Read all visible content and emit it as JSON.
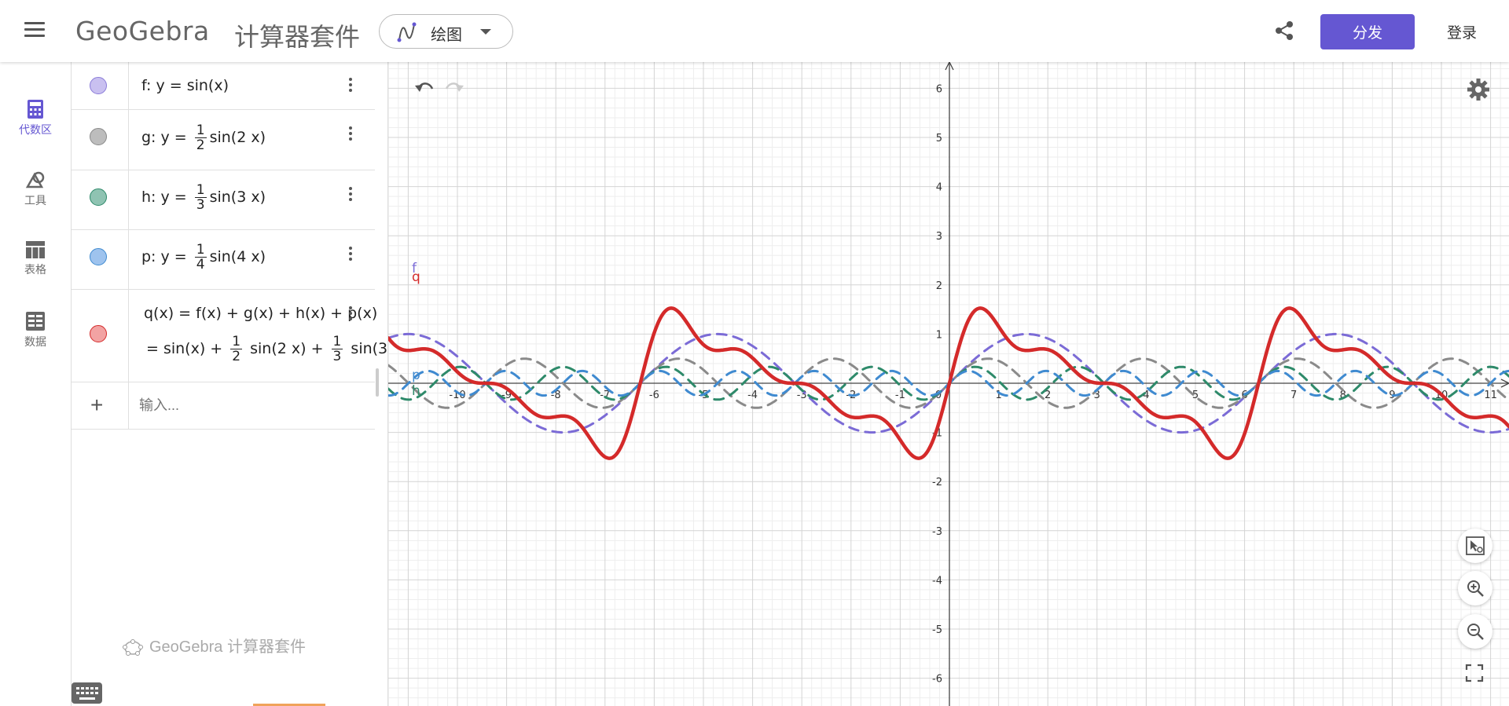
{
  "header": {
    "logo": "GeoGebra",
    "suite_title": "计算器套件",
    "app_picker_label": "绘图",
    "distribute_label": "分发",
    "login_label": "登录",
    "accent_color": "#6557d2"
  },
  "rail": {
    "items": [
      {
        "label": "代数区",
        "icon": "calculator-icon",
        "active": true
      },
      {
        "label": "工具",
        "icon": "tools-icon"
      },
      {
        "label": "表格",
        "icon": "table-icon"
      },
      {
        "label": "数据",
        "icon": "data-icon"
      }
    ]
  },
  "algebra": {
    "rows": [
      {
        "name": "f",
        "prefix": "f: y = ",
        "coef_num": "",
        "coef_den": "",
        "body": "sin(x)",
        "color": "#c9c0f0"
      },
      {
        "name": "g",
        "prefix": "g: y = ",
        "coef_num": "1",
        "coef_den": "2",
        "body": "sin(2 x)",
        "color": "#bdbdbd"
      },
      {
        "name": "h",
        "prefix": "h: y = ",
        "coef_num": "1",
        "coef_den": "3",
        "body": "sin(3 x)",
        "color": "#8fc3b2"
      },
      {
        "name": "p",
        "prefix": "p: y = ",
        "coef_num": "1",
        "coef_den": "4",
        "body": "sin(4 x)",
        "color": "#9ec3ee"
      }
    ],
    "q_row": {
      "line1": "q(x)  =  f(x) + g(x) + h(x) + p(x)",
      "line2_a": "=   sin(x) + ",
      "frac1_num": "1",
      "frac1_den": "2",
      "line2_b": " sin(2 x) + ",
      "frac2_num": "1",
      "frac2_den": "3",
      "line2_c": " sin(3",
      "color": "#f2a3a3"
    },
    "input_placeholder": "输入...",
    "brand": "GeoGebra 计算器套件"
  },
  "graph": {
    "x_range": [
      -11,
      11
    ],
    "y_range": [
      -6,
      6
    ],
    "grid": true,
    "x_ticks": [
      "-10",
      "-9",
      "-8",
      "-7",
      "-6",
      "-5",
      "-4",
      "-3",
      "-2",
      "-1",
      "0",
      "1",
      "2",
      "3",
      "4",
      "5",
      "6",
      "7",
      "8",
      "9",
      "10",
      "11"
    ],
    "y_ticks": [
      "-6",
      "-5",
      "-4",
      "-3",
      "-2",
      "-1",
      "1",
      "2",
      "3",
      "4",
      "5",
      "6"
    ],
    "curve_labels": {
      "f": "f",
      "q": "q",
      "p": "p",
      "h": "h"
    },
    "series": [
      {
        "name": "f",
        "expr": "sin(x)",
        "color": "#7b6bd6",
        "dash": true
      },
      {
        "name": "g",
        "expr": "1/2 sin(2x)",
        "color": "#8a8a8a",
        "dash": true
      },
      {
        "name": "h",
        "expr": "1/3 sin(3x)",
        "color": "#2e8a6a",
        "dash": true
      },
      {
        "name": "p",
        "expr": "1/4 sin(4x)",
        "color": "#3f8ad0",
        "dash": true
      },
      {
        "name": "q",
        "expr": "f+g+h+p",
        "color": "#d42a2a",
        "dash": false
      }
    ]
  }
}
